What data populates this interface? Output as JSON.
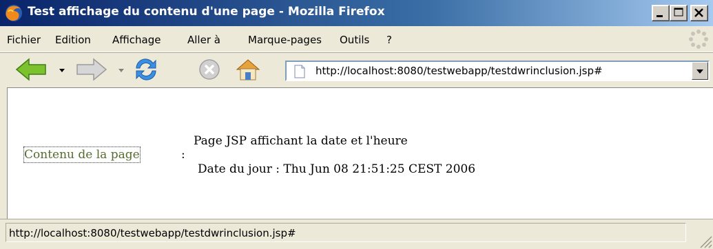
{
  "window": {
    "title": "Test affichage du contenu d'une page - Mozilla Firefox"
  },
  "menu": {
    "items": [
      "Fichier",
      "Edition",
      "Affichage",
      "Aller à",
      "Marque-pages",
      "Outils",
      "?"
    ]
  },
  "toolbar": {
    "buttons": [
      "back-icon",
      "forward-icon",
      "reload-icon",
      "stop-icon",
      "home-icon"
    ],
    "url": "http://localhost:8080/testwebapp/testdwrinclusion.jsp#"
  },
  "content": {
    "link_label": "Contenu de la page",
    "colon": ":",
    "jsp_title": "Page JSP affichant la date et l'heure",
    "date_label": "Date du jour :",
    "date_value": "Thu Jun 08 21:51:25 CEST 2006"
  },
  "status": {
    "text": "http://localhost:8080/testwebapp/testdwrinclusion.jsp#"
  },
  "colors": {
    "title_bar_start": "#0A246A",
    "title_bar_end": "#A6CAF0",
    "link": "#556B2F",
    "chrome": "#ECE9D8"
  }
}
